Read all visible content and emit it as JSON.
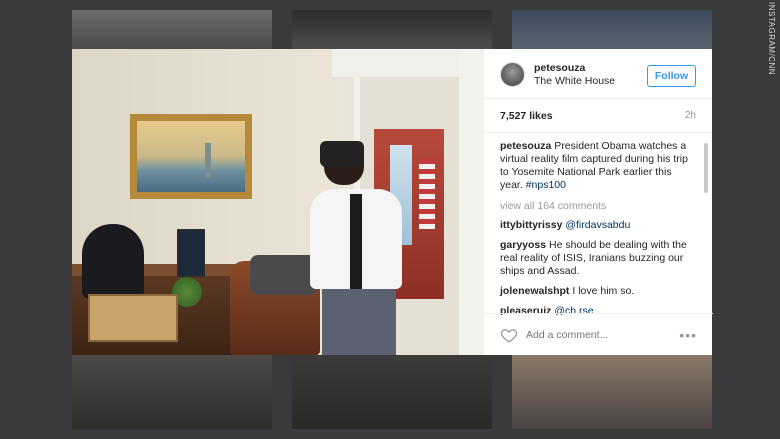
{
  "watermark": "INSTAGRAM/CNN",
  "post": {
    "username": "petesouza",
    "location": "The White House",
    "follow_label": "Follow",
    "likes": "7,527 likes",
    "time": "2h",
    "caption_user": "petesouza",
    "caption_text": " President Obama watches a virtual reality film captured during his trip to Yosemite National Park earlier this year. ",
    "caption_tag": "#nps100",
    "view_all": "view all 164 comments",
    "comments": [
      {
        "user": "ittybittyrissy",
        "text": "",
        "mention": "@firdavsabdu"
      },
      {
        "user": "garyyoss",
        "text": " He should be dealing with the real reality of ISIS, Iranians buzzing our ships and Assad.",
        "mention": ""
      },
      {
        "user": "jolenewalshpt",
        "text": " I love him so.",
        "mention": ""
      },
      {
        "user": "pleaseruiz",
        "text": " ",
        "mention": "@ch.rse"
      }
    ],
    "add_comment_placeholder": "Add a comment...",
    "more_label": "•••"
  },
  "icons": {
    "heart": "heart-icon",
    "more": "more-options-icon",
    "avatar": "avatar"
  },
  "colors": {
    "link_blue": "#3897f0",
    "tag_blue": "#003569",
    "background": "#3a3a3c"
  }
}
